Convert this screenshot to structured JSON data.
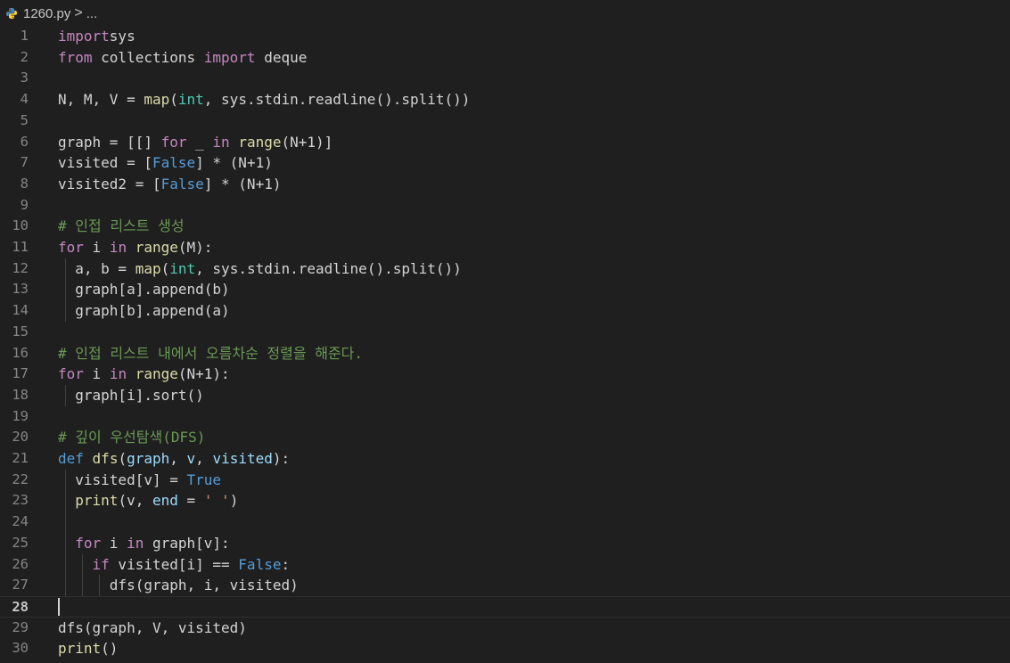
{
  "breadcrumb": {
    "file": "1260.py",
    "separator": ">",
    "more": "...",
    "icon": "python-file-icon"
  },
  "editor": {
    "current_line": 28,
    "lines": [
      {
        "n": "1",
        "t": [
          [
            "kw",
            "import"
          ],
          [
            "",
            "sys"
          ]
        ]
      },
      {
        "n": "2",
        "t": [
          [
            "kw",
            "from"
          ],
          [
            "",
            " collections "
          ],
          [
            "kw",
            "import"
          ],
          [
            "",
            " deque"
          ]
        ]
      },
      {
        "n": "3",
        "t": []
      },
      {
        "n": "4",
        "t": [
          [
            "",
            "N, M, V = "
          ],
          [
            "fn",
            "map"
          ],
          [
            "",
            "("
          ],
          [
            "bi",
            "int"
          ],
          [
            "",
            ", sys.stdin.readline().split())"
          ]
        ]
      },
      {
        "n": "5",
        "t": []
      },
      {
        "n": "6",
        "t": [
          [
            "",
            "graph = [[] "
          ],
          [
            "kw",
            "for"
          ],
          [
            "",
            " _ "
          ],
          [
            "kw",
            "in"
          ],
          [
            "",
            " "
          ],
          [
            "fn",
            "range"
          ],
          [
            "",
            "(N+1)]"
          ]
        ]
      },
      {
        "n": "7",
        "t": [
          [
            "",
            "visited = ["
          ],
          [
            "kw2",
            "False"
          ],
          [
            "",
            "] * (N+1)"
          ]
        ]
      },
      {
        "n": "8",
        "t": [
          [
            "",
            "visited2 = ["
          ],
          [
            "kw2",
            "False"
          ],
          [
            "",
            "] * (N+1)"
          ]
        ]
      },
      {
        "n": "9",
        "t": []
      },
      {
        "n": "10",
        "t": [
          [
            "cm",
            "# 인접 리스트 생성"
          ]
        ]
      },
      {
        "n": "11",
        "t": [
          [
            "kw",
            "for"
          ],
          [
            "",
            " i "
          ],
          [
            "kw",
            "in"
          ],
          [
            "",
            " "
          ],
          [
            "fn",
            "range"
          ],
          [
            "",
            "(M):"
          ]
        ]
      },
      {
        "n": "12",
        "t": [
          [
            "",
            "  a, b = "
          ],
          [
            "fn",
            "map"
          ],
          [
            "",
            "("
          ],
          [
            "bi",
            "int"
          ],
          [
            "",
            ", sys.stdin.readline().split())"
          ]
        ]
      },
      {
        "n": "13",
        "t": [
          [
            "",
            "  graph[a].append(b)"
          ]
        ]
      },
      {
        "n": "14",
        "t": [
          [
            "",
            "  graph[b].append(a)"
          ]
        ]
      },
      {
        "n": "15",
        "t": []
      },
      {
        "n": "16",
        "t": [
          [
            "cm",
            "# 인접 리스트 내에서 오름차순 정렬을 해준다."
          ]
        ]
      },
      {
        "n": "17",
        "t": [
          [
            "kw",
            "for"
          ],
          [
            "",
            " i "
          ],
          [
            "kw",
            "in"
          ],
          [
            "",
            " "
          ],
          [
            "fn",
            "range"
          ],
          [
            "",
            "(N+1):"
          ]
        ]
      },
      {
        "n": "18",
        "t": [
          [
            "",
            "  graph[i].sort()"
          ]
        ]
      },
      {
        "n": "19",
        "t": []
      },
      {
        "n": "20",
        "t": [
          [
            "cm",
            "# 깊이 우선탐색(DFS)"
          ]
        ]
      },
      {
        "n": "21",
        "t": [
          [
            "kw2",
            "def"
          ],
          [
            "",
            " "
          ],
          [
            "fn",
            "dfs"
          ],
          [
            "",
            "("
          ],
          [
            "par",
            "graph"
          ],
          [
            "",
            ", "
          ],
          [
            "par",
            "v"
          ],
          [
            "",
            ", "
          ],
          [
            "par",
            "visited"
          ],
          [
            "",
            "):"
          ]
        ]
      },
      {
        "n": "22",
        "t": [
          [
            "",
            "  visited[v] = "
          ],
          [
            "kw2",
            "True"
          ]
        ]
      },
      {
        "n": "23",
        "t": [
          [
            "",
            "  "
          ],
          [
            "fn",
            "print"
          ],
          [
            "",
            "(v, "
          ],
          [
            "par",
            "end"
          ],
          [
            "",
            " = "
          ],
          [
            "st",
            "' '"
          ],
          [
            "",
            ")"
          ]
        ]
      },
      {
        "n": "24",
        "t": []
      },
      {
        "n": "25",
        "t": [
          [
            "",
            "  "
          ],
          [
            "kw",
            "for"
          ],
          [
            "",
            " i "
          ],
          [
            "kw",
            "in"
          ],
          [
            "",
            " graph[v]:"
          ]
        ]
      },
      {
        "n": "26",
        "t": [
          [
            "",
            "    "
          ],
          [
            "kw",
            "if"
          ],
          [
            "",
            " visited[i] == "
          ],
          [
            "kw2",
            "False"
          ],
          [
            "",
            ":"
          ]
        ]
      },
      {
        "n": "27",
        "t": [
          [
            "",
            "      dfs(graph, i, visited)"
          ]
        ]
      },
      {
        "n": "28",
        "t": []
      },
      {
        "n": "29",
        "t": [
          [
            "",
            "dfs(graph, V, visited)"
          ]
        ]
      },
      {
        "n": "30",
        "t": [
          [
            "fn",
            "print"
          ],
          [
            "",
            "()"
          ]
        ]
      }
    ]
  },
  "colors": {
    "background": "#1f1f1f",
    "keyword_control": "#c586c0",
    "keyword_constant": "#569cd6",
    "function": "#dcdcaa",
    "builtin_type": "#4ec9b0",
    "comment": "#6a9955",
    "string": "#ce9178",
    "parameter": "#9cdcfe",
    "text": "#d4d4d4"
  }
}
